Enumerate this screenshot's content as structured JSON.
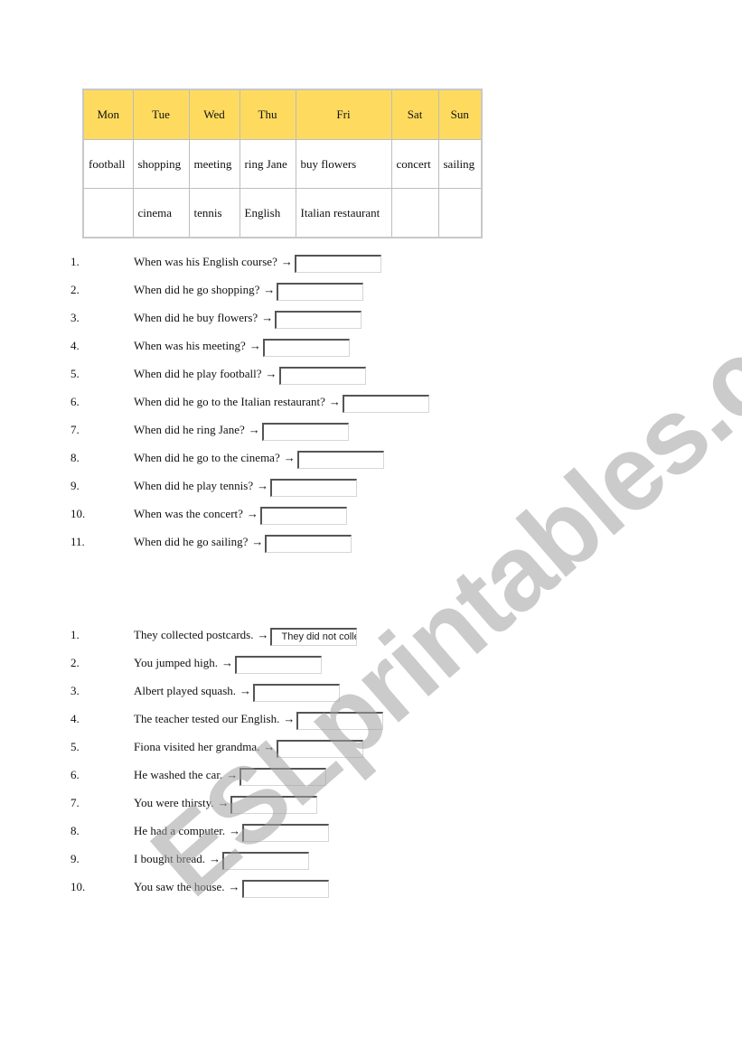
{
  "schedule": {
    "headers": [
      "Mon",
      "Tue",
      "Wed",
      "Thu",
      "Fri",
      "Sat",
      "Sun"
    ],
    "rows": [
      [
        "football",
        "shopping",
        "meeting",
        "ring Jane",
        "buy flowers",
        "concert",
        "sailing"
      ],
      [
        "",
        "cinema",
        "tennis",
        "English",
        "Italian restaurant",
        "",
        ""
      ]
    ],
    "header_color": "#fedb5f"
  },
  "arrow": "→",
  "exercise1": [
    {
      "num": "1.",
      "text": "When was his English course?",
      "answer": ""
    },
    {
      "num": "2.",
      "text": "When did he go shopping?",
      "answer": ""
    },
    {
      "num": "3.",
      "text": "When did he buy flowers?",
      "answer": ""
    },
    {
      "num": "4.",
      "text": "When was his meeting?",
      "answer": ""
    },
    {
      "num": "5.",
      "text": "When did he play football?",
      "answer": ""
    },
    {
      "num": "6.",
      "text": "When did he go to the Italian restaurant?",
      "answer": ""
    },
    {
      "num": "7.",
      "text": "When did he ring Jane?",
      "answer": ""
    },
    {
      "num": "8.",
      "text": "When did he go to the cinema?",
      "answer": ""
    },
    {
      "num": "9.",
      "text": "When did he play tennis?",
      "answer": ""
    },
    {
      "num": "10.",
      "text": "When was the concert?",
      "answer": ""
    },
    {
      "num": "11.",
      "text": "When did he go sailing?",
      "answer": ""
    }
  ],
  "exercise2": [
    {
      "num": "1.",
      "text": "They collected postcards.",
      "answer": "They did not colle"
    },
    {
      "num": "2.",
      "text": "You jumped high.",
      "answer": ""
    },
    {
      "num": "3.",
      "text": "Albert played squash.",
      "answer": ""
    },
    {
      "num": "4.",
      "text": "The teacher tested our English.",
      "answer": ""
    },
    {
      "num": "5.",
      "text": "Fiona visited her grandma.",
      "answer": ""
    },
    {
      "num": "6.",
      "text": "He washed the car.",
      "answer": ""
    },
    {
      "num": "7.",
      "text": "You were thirsty.",
      "answer": ""
    },
    {
      "num": "8.",
      "text": "He had a computer.",
      "answer": ""
    },
    {
      "num": "9.",
      "text": "I bought bread.",
      "answer": ""
    },
    {
      "num": "10.",
      "text": "You saw the house.",
      "answer": ""
    }
  ],
  "watermark": "ESLprintables.com"
}
